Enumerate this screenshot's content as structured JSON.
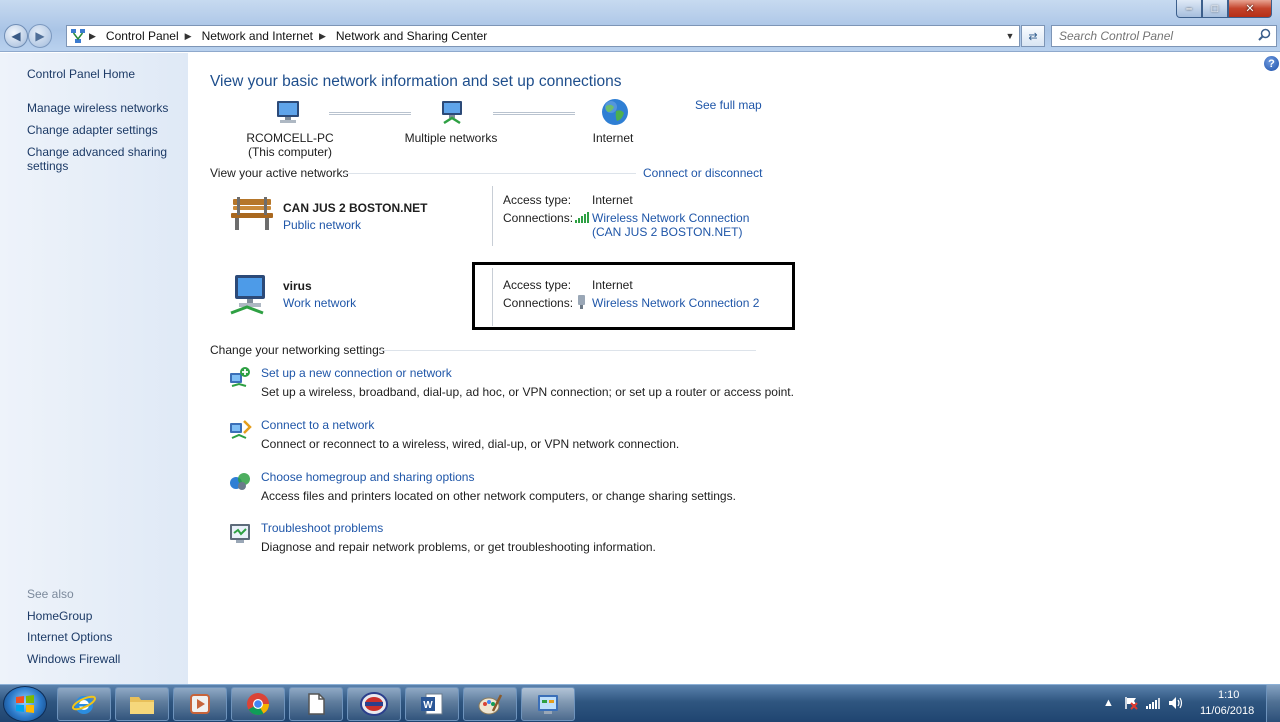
{
  "window": {
    "caption_buttons": [
      "minimize",
      "maximize",
      "close"
    ]
  },
  "address_bar": {
    "breadcrumbs": [
      "Control Panel",
      "Network and Internet",
      "Network and Sharing Center"
    ],
    "search_placeholder": "Search Control Panel"
  },
  "sidebar": {
    "home": "Control Panel Home",
    "links": [
      "Manage wireless networks",
      "Change adapter settings",
      "Change advanced sharing settings"
    ],
    "see_also_title": "See also",
    "see_also": [
      "HomeGroup",
      "Internet Options",
      "Windows Firewall"
    ]
  },
  "main": {
    "heading": "View your basic network information and set up connections",
    "see_full_map": "See full map",
    "map": {
      "computer_name": "RCOMCELL-PC",
      "computer_sub": "(This computer)",
      "middle": "Multiple networks",
      "internet": "Internet"
    },
    "active_networks_title": "View your active networks",
    "connect_or_disconnect": "Connect or disconnect",
    "networks": [
      {
        "name": "CAN JUS 2 BOSTON.NET",
        "type": "Public network",
        "access_type_label": "Access type:",
        "access_type": "Internet",
        "connections_label": "Connections:",
        "connection": "Wireless Network Connection",
        "connection_sub": "(CAN JUS 2 BOSTON.NET)"
      },
      {
        "name": "virus",
        "type": "Work network",
        "access_type_label": "Access type:",
        "access_type": "Internet",
        "connections_label": "Connections:",
        "connection": "Wireless Network Connection 2"
      }
    ],
    "change_settings_title": "Change your networking settings",
    "tasks": [
      {
        "title": "Set up a new connection or network",
        "desc": "Set up a wireless, broadband, dial-up, ad hoc, or VPN connection; or set up a router or access point."
      },
      {
        "title": "Connect to a network",
        "desc": "Connect or reconnect to a wireless, wired, dial-up, or VPN network connection."
      },
      {
        "title": "Choose homegroup and sharing options",
        "desc": "Access files and printers located on other network computers, or change sharing settings."
      },
      {
        "title": "Troubleshoot problems",
        "desc": "Diagnose and repair network problems, or get troubleshooting information."
      }
    ]
  },
  "taskbar": {
    "pinned": [
      "internet-explorer",
      "file-explorer",
      "media-player",
      "chrome",
      "documents",
      "rcomcell-app",
      "word",
      "paint",
      "network-control-panel"
    ],
    "clock_time": "1:10",
    "clock_date": "11/06/2018"
  }
}
